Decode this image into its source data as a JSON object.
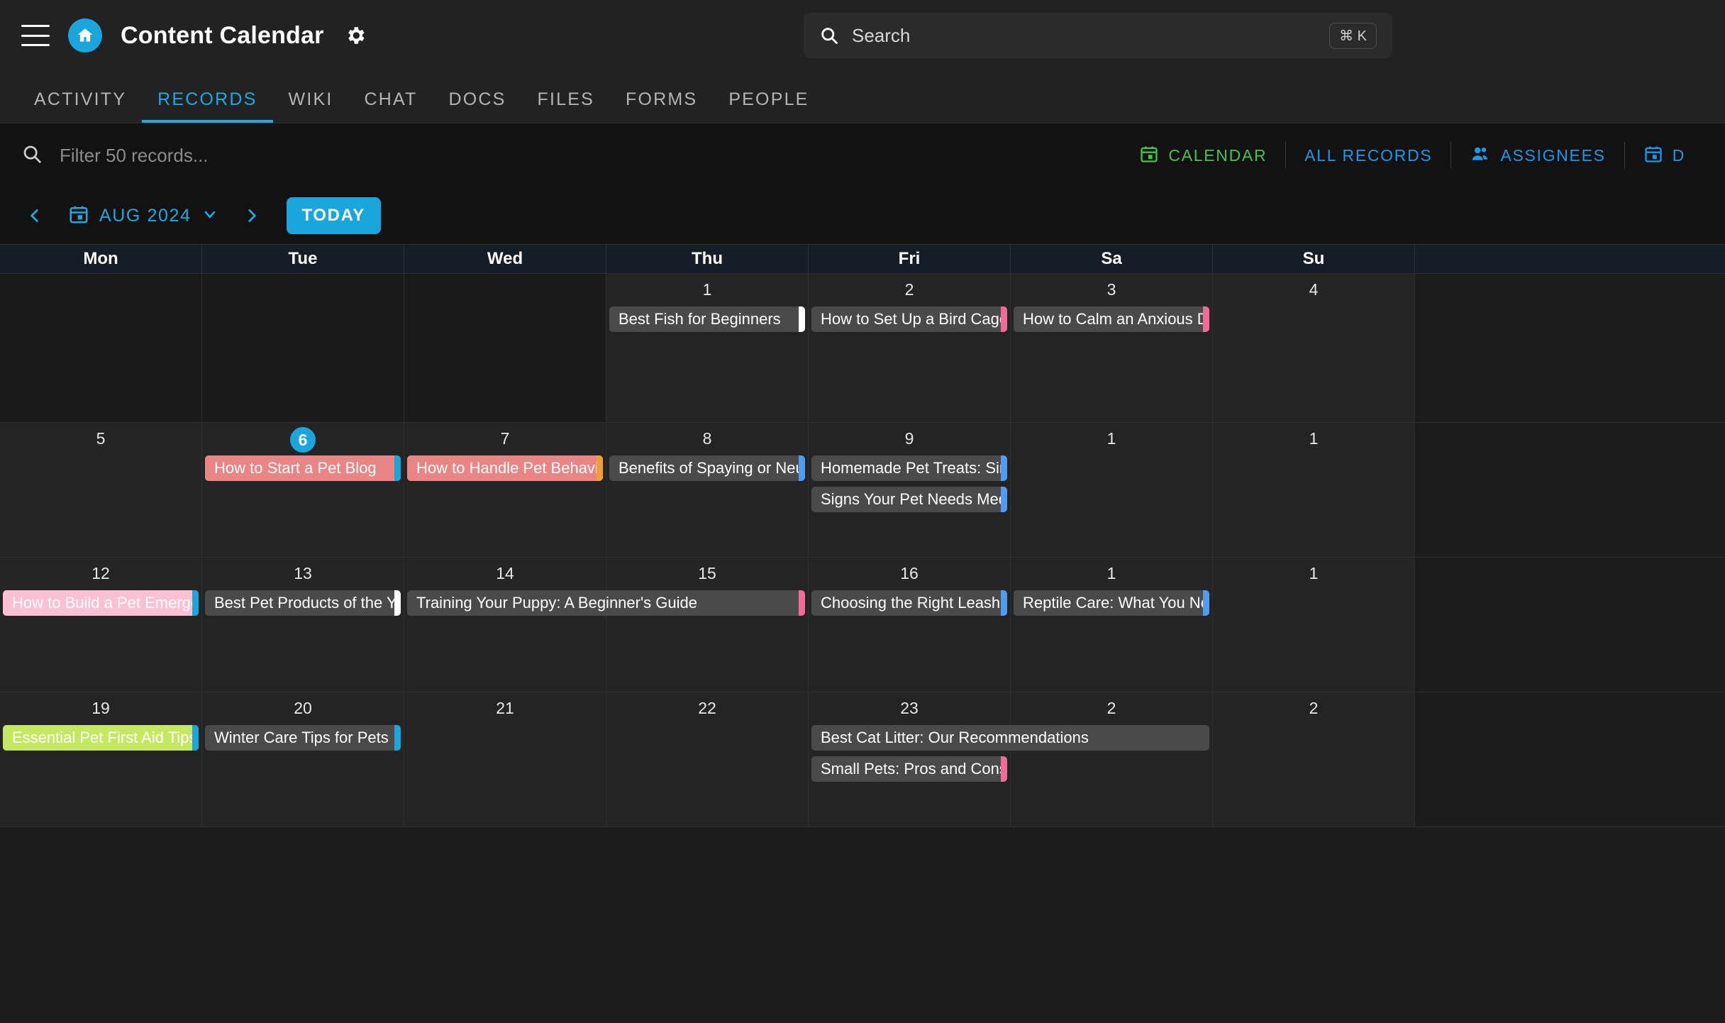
{
  "header": {
    "menu_icon": "hamburger-icon",
    "home_icon": "home-icon",
    "title": "Content Calendar",
    "settings_icon": "gear-icon"
  },
  "search": {
    "icon": "search-icon",
    "placeholder": "Search",
    "value": "",
    "shortcut": "⌘ K"
  },
  "tabs": [
    {
      "label": "ACTIVITY",
      "active": false
    },
    {
      "label": "RECORDS",
      "active": true
    },
    {
      "label": "WIKI",
      "active": false
    },
    {
      "label": "CHAT",
      "active": false
    },
    {
      "label": "DOCS",
      "active": false
    },
    {
      "label": "FILES",
      "active": false
    },
    {
      "label": "FORMS",
      "active": false
    },
    {
      "label": "PEOPLE",
      "active": false
    }
  ],
  "filter": {
    "icon": "search-icon",
    "placeholder": "Filter 50 records...",
    "value": ""
  },
  "view_actions": [
    {
      "label": "CALENDAR",
      "icon": "calendar-icon",
      "color": "#49c24a",
      "active": true
    },
    {
      "label": "ALL RECORDS",
      "icon": "",
      "color": "#2196e8",
      "active": false
    },
    {
      "label": "ASSIGNEES",
      "icon": "people-icon",
      "color": "#2196e8",
      "active": false
    },
    {
      "label": "D",
      "icon": "calendar-icon",
      "color": "#2196e8",
      "active": false
    }
  ],
  "datenav": {
    "prev_icon": "chevron-left-icon",
    "next_icon": "chevron-right-icon",
    "calendar_icon": "calendar-icon",
    "month_label": "AUG 2024",
    "dropdown_icon": "chevron-down-icon",
    "today_label": "TODAY"
  },
  "calendar": {
    "weekdays": [
      "Mon",
      "Tue",
      "Wed",
      "Thu",
      "Fri",
      "Sa",
      "Su"
    ],
    "today": 6,
    "weeks": [
      {
        "days": [
          "",
          "",
          "",
          "1",
          "2",
          "3",
          "4"
        ]
      },
      {
        "days": [
          "5",
          "6",
          "7",
          "8",
          "9",
          "1",
          "1"
        ]
      },
      {
        "days": [
          "12",
          "13",
          "14",
          "15",
          "16",
          "1",
          "1"
        ]
      },
      {
        "days": [
          "19",
          "20",
          "21",
          "22",
          "23",
          "2",
          "2"
        ]
      }
    ],
    "events": [
      {
        "title": "Best Fish for Beginners",
        "week": 0,
        "col": 3,
        "span": 1,
        "slot": 0,
        "tone": "gray",
        "accent": "#ffffff"
      },
      {
        "title": "How to Set Up a Bird Cage",
        "week": 0,
        "col": 4,
        "span": 1,
        "slot": 0,
        "tone": "gray",
        "accent": "#f06a9a"
      },
      {
        "title": "How to Calm an Anxious Dog",
        "week": 0,
        "col": 5,
        "span": 1,
        "slot": 0,
        "tone": "gray",
        "accent": "#f06a9a"
      },
      {
        "title": "How to Start a Pet Blog",
        "week": 1,
        "col": 1,
        "span": 1,
        "slot": 0,
        "tone": "salmon",
        "accent": "#1aa6dd"
      },
      {
        "title": "How to Handle Pet Behavior Problems",
        "week": 1,
        "col": 2,
        "span": 1,
        "slot": 0,
        "tone": "salmon",
        "accent": "#f0a032"
      },
      {
        "title": "Benefits of Spaying or Neutering Your Pet",
        "week": 1,
        "col": 3,
        "span": 1,
        "slot": 0,
        "tone": "gray",
        "accent": "#4f9cf0"
      },
      {
        "title": "Homemade Pet Treats: Simple Recipes",
        "week": 1,
        "col": 4,
        "span": 1,
        "slot": 0,
        "tone": "gray",
        "accent": "#4f9cf0"
      },
      {
        "title": "Signs Your Pet Needs Medical Attention",
        "week": 1,
        "col": 4,
        "span": 1,
        "slot": 1,
        "tone": "gray",
        "accent": "#4f9cf0"
      },
      {
        "title": "How to Build a Pet Emergency Kit",
        "week": 2,
        "col": 0,
        "span": 1,
        "slot": 0,
        "tone": "pink",
        "accent": "#1aa6dd"
      },
      {
        "title": "Best Pet Products of the Year",
        "week": 2,
        "col": 1,
        "span": 1,
        "slot": 0,
        "tone": "gray",
        "accent": "#ffffff"
      },
      {
        "title": "Training Your Puppy: A Beginner's Guide",
        "week": 2,
        "col": 2,
        "span": 2,
        "slot": 0,
        "tone": "gray",
        "accent": "#f06a9a"
      },
      {
        "title": "Choosing the Right Leash and Collar",
        "week": 2,
        "col": 4,
        "span": 1,
        "slot": 0,
        "tone": "gray",
        "accent": "#4f9cf0"
      },
      {
        "title": "Reptile Care: What You Need to Know",
        "week": 2,
        "col": 5,
        "span": 1,
        "slot": 0,
        "tone": "gray",
        "accent": "#4f9cf0"
      },
      {
        "title": "Essential Pet First Aid Tips",
        "week": 3,
        "col": 0,
        "span": 1,
        "slot": 0,
        "tone": "lime",
        "accent": "#1aa6dd"
      },
      {
        "title": "Winter Care Tips for Pets",
        "week": 3,
        "col": 1,
        "span": 1,
        "slot": 0,
        "tone": "gray",
        "accent": "#1aa6dd"
      },
      {
        "title": "Best Cat Litter: Our Recommendations",
        "week": 3,
        "col": 4,
        "span": 2,
        "slot": 0,
        "tone": "gray",
        "accent": ""
      },
      {
        "title": "Small Pets: Pros and Cons",
        "week": 3,
        "col": 4,
        "span": 1,
        "slot": 1,
        "tone": "gray",
        "accent": "#f06a9a"
      }
    ]
  }
}
